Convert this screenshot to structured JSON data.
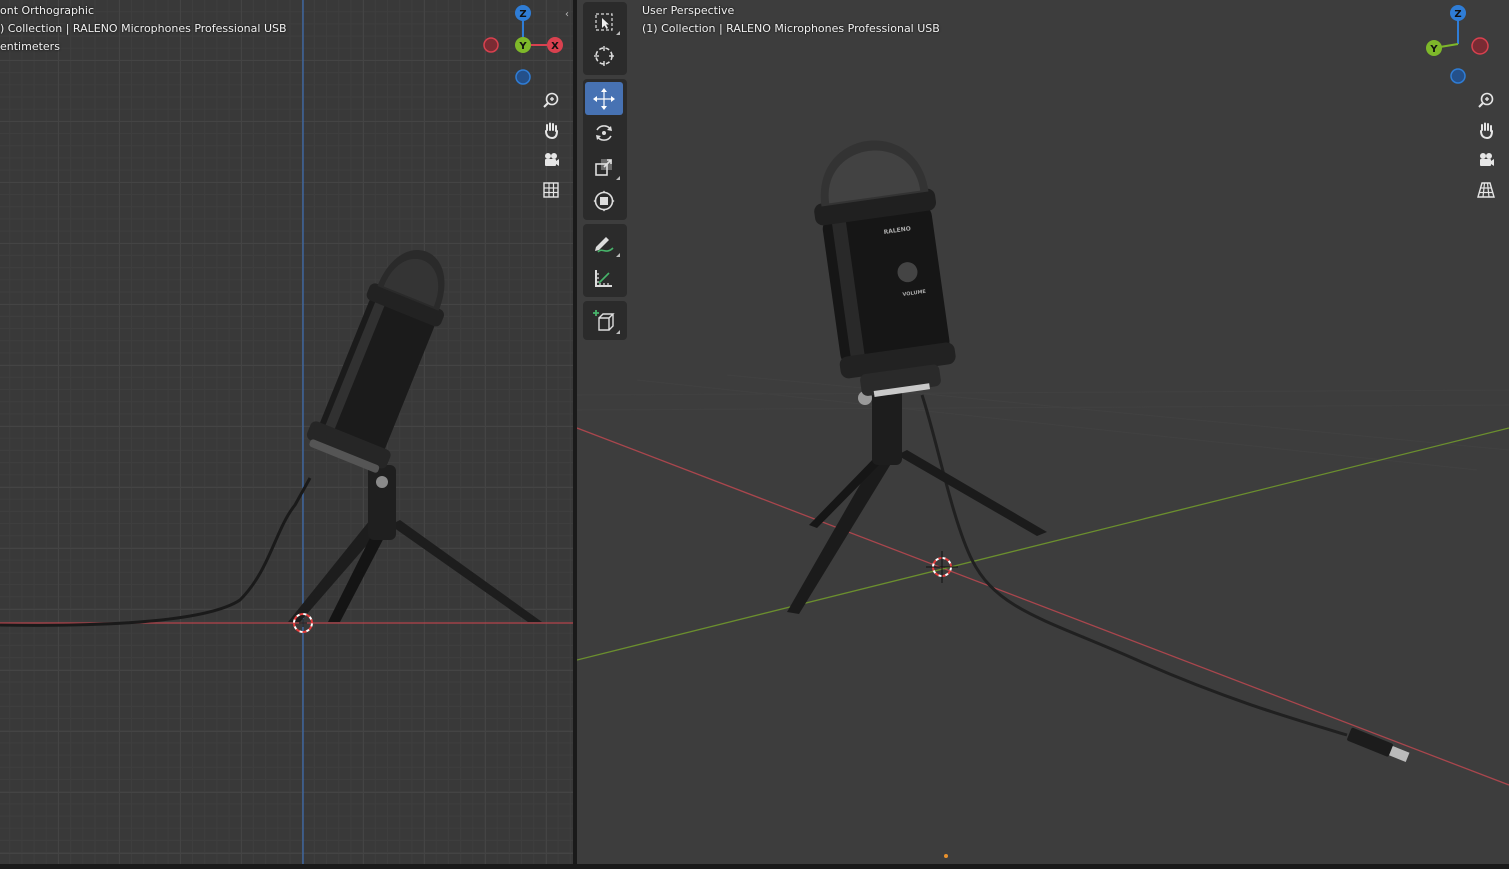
{
  "left_viewport": {
    "view_name": "ont Orthographic",
    "collection": ") Collection | RALENO Microphones Professional USB",
    "units": "entimeters",
    "gizmo": {
      "z": "Z",
      "y": "Y",
      "x": "X"
    }
  },
  "right_viewport": {
    "view_name": "User Perspective",
    "collection": "(1) Collection | RALENO Microphones Professional USB",
    "gizmo": {
      "z": "Z",
      "y": "Y"
    },
    "model_text": {
      "brand": "RALENO",
      "knob": "VOLUME"
    }
  },
  "nav_icons": [
    "zoom-icon",
    "hand-pan-icon",
    "camera-icon",
    "grid-toggle-icon"
  ],
  "toolbar": {
    "tools": [
      "select-box",
      "cursor",
      "move",
      "rotate",
      "scale",
      "transform",
      "annotate",
      "measure",
      "add-cube"
    ],
    "active": "move"
  },
  "colors": {
    "x_axis": "#d9414f",
    "y_axis": "#7eb82a",
    "z_axis": "#2f7dd6",
    "viewport_bg": "#3d3d3d",
    "grid_bg": "#393939",
    "active_tool": "#4772b3"
  }
}
